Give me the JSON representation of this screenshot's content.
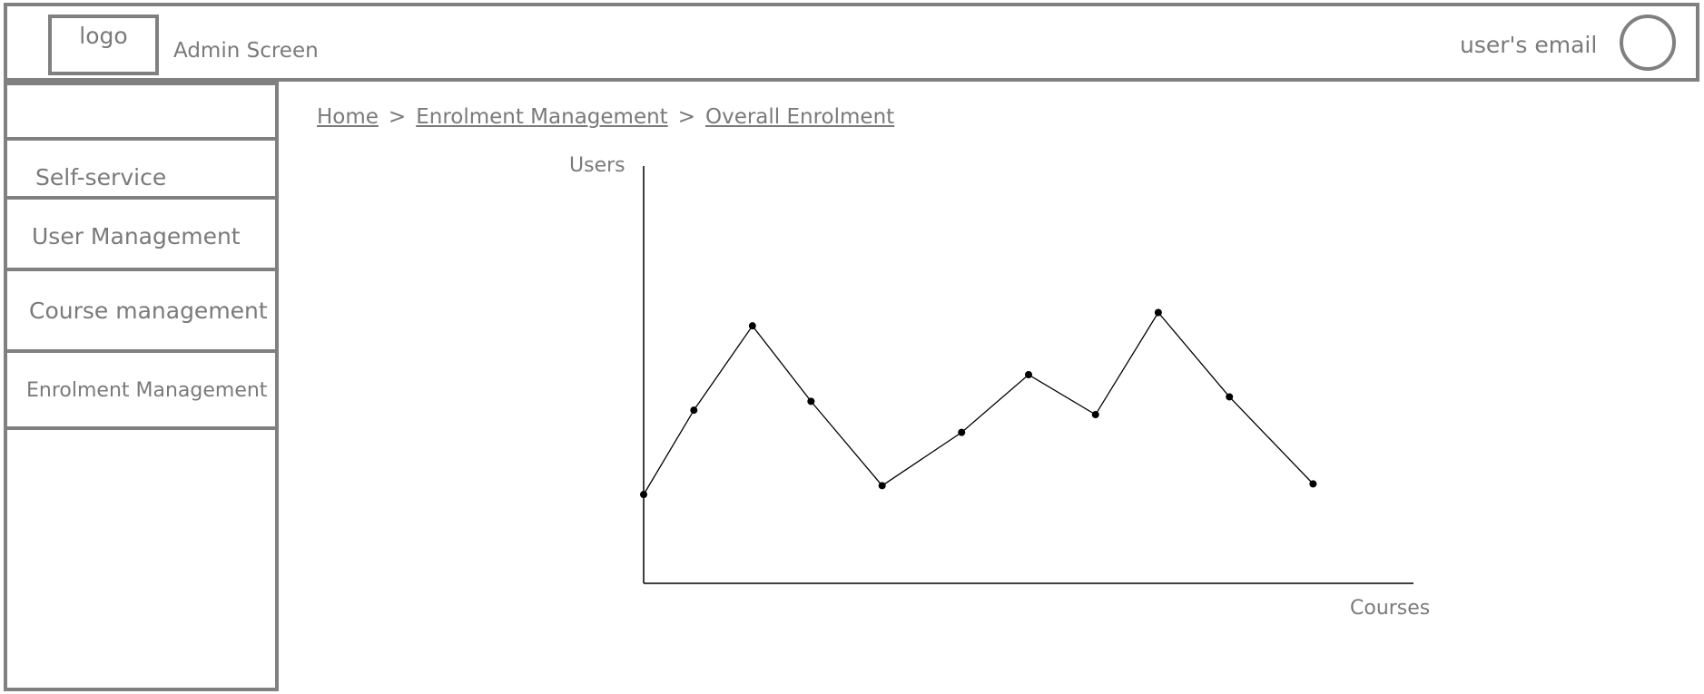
{
  "header": {
    "logo_text": "logo",
    "app_title": "Admin Screen",
    "user_email": "user's email"
  },
  "sidebar": {
    "items": [
      {
        "label": "Self-service"
      },
      {
        "label": "User Management"
      },
      {
        "label": "Course management"
      },
      {
        "label": "Enrolment Management"
      }
    ]
  },
  "breadcrumb": {
    "items": [
      "Home",
      "Enrolment Management",
      "Overall Enrolment"
    ],
    "separator": ">"
  },
  "chart_data": {
    "type": "line",
    "xlabel": "Courses",
    "ylabel": "Users",
    "grid": false,
    "x": [
      0,
      0.6,
      1.3,
      2.0,
      2.85,
      3.8,
      4.6,
      5.4,
      6.15,
      7.0,
      8.0
    ],
    "values": [
      10,
      19.5,
      29,
      20.5,
      11,
      17,
      23.5,
      19,
      30.5,
      21,
      11.2
    ],
    "xlim": [
      0,
      9.2
    ],
    "ylim": [
      0,
      47
    ]
  }
}
